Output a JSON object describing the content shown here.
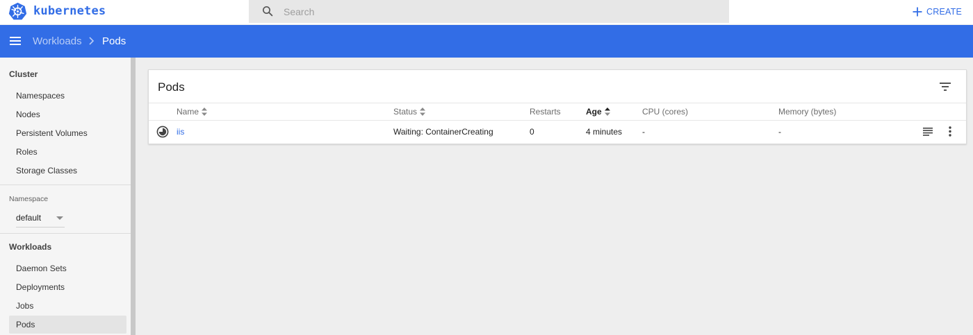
{
  "app": {
    "brand": "kubernetes",
    "search_placeholder": "Search",
    "create_label": "CREATE"
  },
  "toolbar": {
    "breadcrumb": [
      "Workloads",
      "Pods"
    ]
  },
  "sidebar": {
    "cluster_heading": "Cluster",
    "cluster_items": [
      "Namespaces",
      "Nodes",
      "Persistent Volumes",
      "Roles",
      "Storage Classes"
    ],
    "namespace_label": "Namespace",
    "namespace_value": "default",
    "workloads_heading": "Workloads",
    "workloads_items": [
      "Daemon Sets",
      "Deployments",
      "Jobs",
      "Pods"
    ],
    "active_item": "Pods"
  },
  "card": {
    "title": "Pods",
    "columns": [
      "Name",
      "Status",
      "Restarts",
      "Age",
      "CPU (cores)",
      "Memory (bytes)"
    ],
    "sorted_column": "Age",
    "rows": [
      {
        "name": "iis",
        "status": "Waiting: ContainerCreating",
        "restarts": "0",
        "age": "4 minutes",
        "cpu": "-",
        "memory": "-",
        "status_icon": "pending-icon"
      }
    ]
  },
  "colors": {
    "accent": "#326de6",
    "background": "#eeeeee",
    "sidebar": "#f5f5f5"
  }
}
